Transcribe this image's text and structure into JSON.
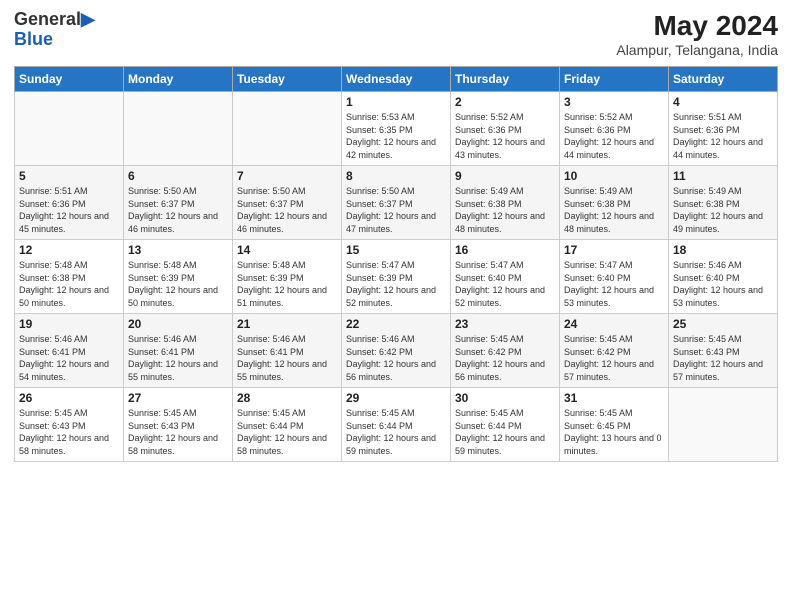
{
  "header": {
    "logo_general": "General",
    "logo_blue": "Blue",
    "main_title": "May 2024",
    "subtitle": "Alampur, Telangana, India"
  },
  "days_header": [
    "Sunday",
    "Monday",
    "Tuesday",
    "Wednesday",
    "Thursday",
    "Friday",
    "Saturday"
  ],
  "weeks": [
    [
      {
        "day": "",
        "sunrise": "",
        "sunset": "",
        "daylight": ""
      },
      {
        "day": "",
        "sunrise": "",
        "sunset": "",
        "daylight": ""
      },
      {
        "day": "",
        "sunrise": "",
        "sunset": "",
        "daylight": ""
      },
      {
        "day": "1",
        "sunrise": "5:53 AM",
        "sunset": "6:35 PM",
        "daylight": "12 hours and 42 minutes."
      },
      {
        "day": "2",
        "sunrise": "5:52 AM",
        "sunset": "6:36 PM",
        "daylight": "12 hours and 43 minutes."
      },
      {
        "day": "3",
        "sunrise": "5:52 AM",
        "sunset": "6:36 PM",
        "daylight": "12 hours and 44 minutes."
      },
      {
        "day": "4",
        "sunrise": "5:51 AM",
        "sunset": "6:36 PM",
        "daylight": "12 hours and 44 minutes."
      }
    ],
    [
      {
        "day": "5",
        "sunrise": "5:51 AM",
        "sunset": "6:36 PM",
        "daylight": "12 hours and 45 minutes."
      },
      {
        "day": "6",
        "sunrise": "5:50 AM",
        "sunset": "6:37 PM",
        "daylight": "12 hours and 46 minutes."
      },
      {
        "day": "7",
        "sunrise": "5:50 AM",
        "sunset": "6:37 PM",
        "daylight": "12 hours and 46 minutes."
      },
      {
        "day": "8",
        "sunrise": "5:50 AM",
        "sunset": "6:37 PM",
        "daylight": "12 hours and 47 minutes."
      },
      {
        "day": "9",
        "sunrise": "5:49 AM",
        "sunset": "6:38 PM",
        "daylight": "12 hours and 48 minutes."
      },
      {
        "day": "10",
        "sunrise": "5:49 AM",
        "sunset": "6:38 PM",
        "daylight": "12 hours and 48 minutes."
      },
      {
        "day": "11",
        "sunrise": "5:49 AM",
        "sunset": "6:38 PM",
        "daylight": "12 hours and 49 minutes."
      }
    ],
    [
      {
        "day": "12",
        "sunrise": "5:48 AM",
        "sunset": "6:38 PM",
        "daylight": "12 hours and 50 minutes."
      },
      {
        "day": "13",
        "sunrise": "5:48 AM",
        "sunset": "6:39 PM",
        "daylight": "12 hours and 50 minutes."
      },
      {
        "day": "14",
        "sunrise": "5:48 AM",
        "sunset": "6:39 PM",
        "daylight": "12 hours and 51 minutes."
      },
      {
        "day": "15",
        "sunrise": "5:47 AM",
        "sunset": "6:39 PM",
        "daylight": "12 hours and 52 minutes."
      },
      {
        "day": "16",
        "sunrise": "5:47 AM",
        "sunset": "6:40 PM",
        "daylight": "12 hours and 52 minutes."
      },
      {
        "day": "17",
        "sunrise": "5:47 AM",
        "sunset": "6:40 PM",
        "daylight": "12 hours and 53 minutes."
      },
      {
        "day": "18",
        "sunrise": "5:46 AM",
        "sunset": "6:40 PM",
        "daylight": "12 hours and 53 minutes."
      }
    ],
    [
      {
        "day": "19",
        "sunrise": "5:46 AM",
        "sunset": "6:41 PM",
        "daylight": "12 hours and 54 minutes."
      },
      {
        "day": "20",
        "sunrise": "5:46 AM",
        "sunset": "6:41 PM",
        "daylight": "12 hours and 55 minutes."
      },
      {
        "day": "21",
        "sunrise": "5:46 AM",
        "sunset": "6:41 PM",
        "daylight": "12 hours and 55 minutes."
      },
      {
        "day": "22",
        "sunrise": "5:46 AM",
        "sunset": "6:42 PM",
        "daylight": "12 hours and 56 minutes."
      },
      {
        "day": "23",
        "sunrise": "5:45 AM",
        "sunset": "6:42 PM",
        "daylight": "12 hours and 56 minutes."
      },
      {
        "day": "24",
        "sunrise": "5:45 AM",
        "sunset": "6:42 PM",
        "daylight": "12 hours and 57 minutes."
      },
      {
        "day": "25",
        "sunrise": "5:45 AM",
        "sunset": "6:43 PM",
        "daylight": "12 hours and 57 minutes."
      }
    ],
    [
      {
        "day": "26",
        "sunrise": "5:45 AM",
        "sunset": "6:43 PM",
        "daylight": "12 hours and 58 minutes."
      },
      {
        "day": "27",
        "sunrise": "5:45 AM",
        "sunset": "6:43 PM",
        "daylight": "12 hours and 58 minutes."
      },
      {
        "day": "28",
        "sunrise": "5:45 AM",
        "sunset": "6:44 PM",
        "daylight": "12 hours and 58 minutes."
      },
      {
        "day": "29",
        "sunrise": "5:45 AM",
        "sunset": "6:44 PM",
        "daylight": "12 hours and 59 minutes."
      },
      {
        "day": "30",
        "sunrise": "5:45 AM",
        "sunset": "6:44 PM",
        "daylight": "12 hours and 59 minutes."
      },
      {
        "day": "31",
        "sunrise": "5:45 AM",
        "sunset": "6:45 PM",
        "daylight": "13 hours and 0 minutes."
      },
      {
        "day": "",
        "sunrise": "",
        "sunset": "",
        "daylight": ""
      }
    ]
  ],
  "labels": {
    "sunrise": "Sunrise:",
    "sunset": "Sunset:",
    "daylight": "Daylight:"
  }
}
